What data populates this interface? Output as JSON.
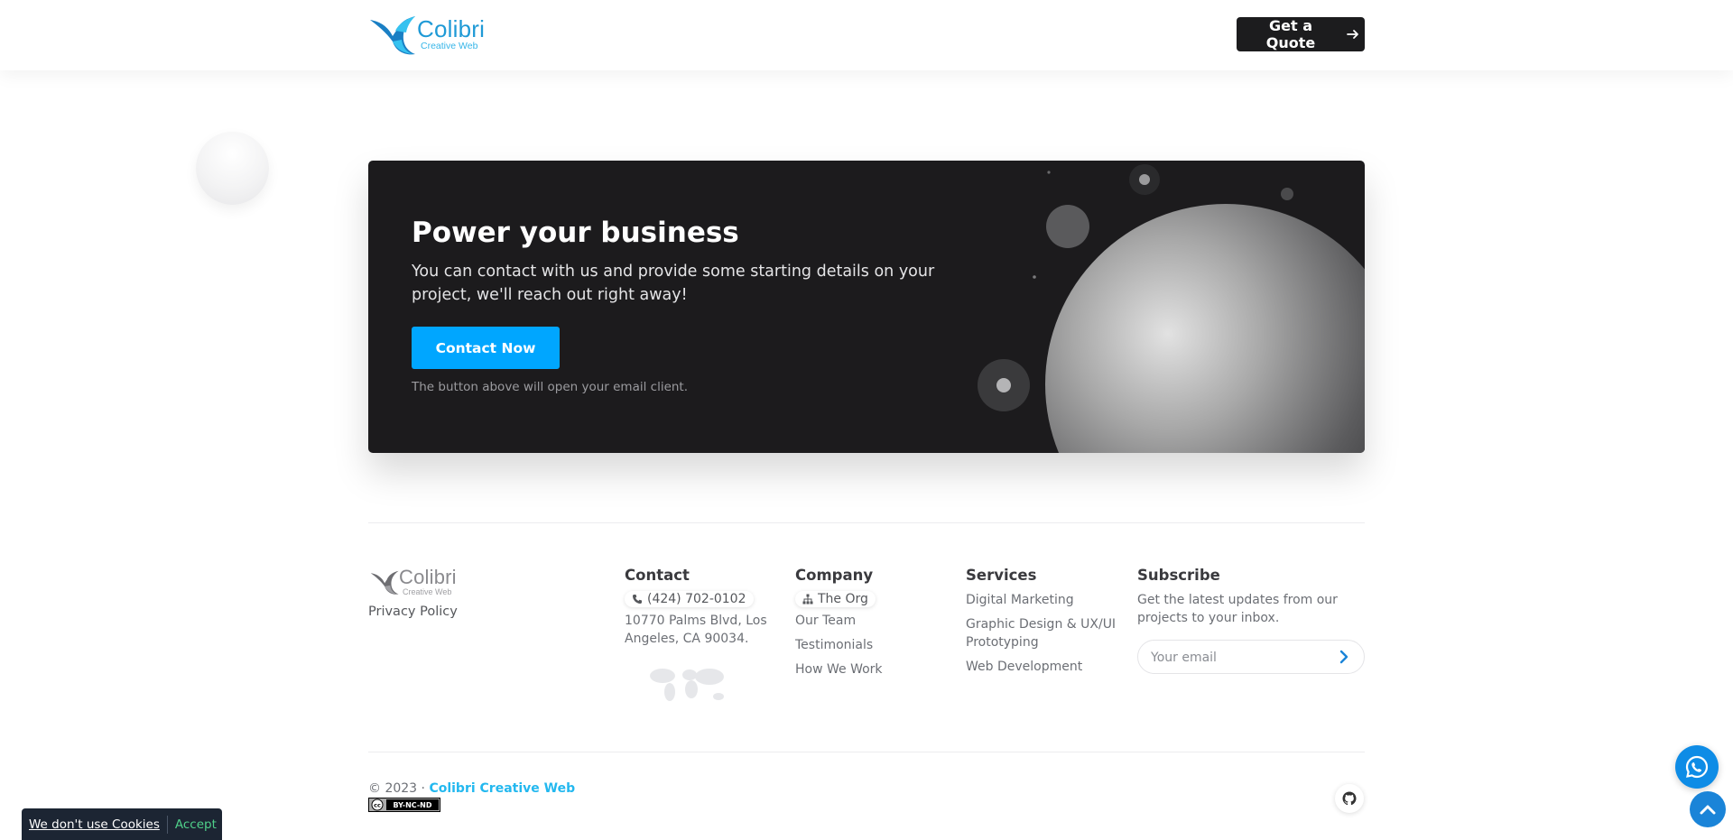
{
  "header": {
    "logo_name": "Colibri",
    "logo_tagline": "Creative Web",
    "quote_button": "Get a Quote"
  },
  "cta": {
    "title": "Power your business",
    "text": "You can contact with us and provide some starting details on your project, we'll reach out right away!",
    "button": "Contact Now",
    "note": "The button above will open your email client."
  },
  "footer": {
    "logo_name": "Colibri",
    "logo_tagline": "Creative Web",
    "privacy": "Privacy Policy",
    "contact": {
      "heading": "Contact",
      "phone": "(424) 702-0102",
      "address": "10770 Palms Blvd, Los Angeles, CA 90034."
    },
    "company": {
      "heading": "Company",
      "org": "The Org",
      "links": [
        "Our Team",
        "Testimonials",
        "How We Work"
      ]
    },
    "services": {
      "heading": "Services",
      "links": [
        "Digital Marketing",
        "Graphic Design & UX/UI Prototyping",
        "Web Development"
      ]
    },
    "subscribe": {
      "heading": "Subscribe",
      "text": "Get the latest updates from our projects to your inbox.",
      "placeholder": "Your email"
    },
    "copyright_prefix": "© 2023 · ",
    "brand": "Colibri Creative Web",
    "license_badge": "BY-NC-ND"
  },
  "cookie": {
    "message": "We don't use Cookies",
    "accept": "Accept"
  },
  "colors": {
    "accent": "#00a6ff",
    "dark_card": "#1c1b1d",
    "brand_link": "#23b8ef",
    "cookie_accept": "#4fd08a"
  },
  "icons": [
    "colibri-bird-logo",
    "arrow-right-icon",
    "phone-icon",
    "sitemap-icon",
    "chevron-right-icon",
    "github-icon",
    "whatsapp-icon",
    "chevron-up-icon",
    "creative-commons-icon"
  ]
}
